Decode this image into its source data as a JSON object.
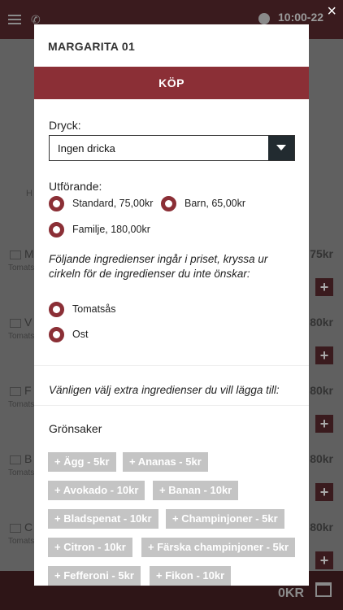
{
  "background": {
    "time": "10:00-22",
    "rows": [
      {
        "name": "M",
        "sub": "Tomats",
        "price": "75kr"
      },
      {
        "name": "V",
        "sub": "Tomats",
        "price": "80kr"
      },
      {
        "name": "F",
        "sub": "Tomats",
        "price": "80kr"
      },
      {
        "name": "B",
        "sub": "Tomats",
        "price": "80kr"
      },
      {
        "name": "C",
        "sub": "Tomats",
        "price": "80kr"
      }
    ],
    "hint": "H",
    "total": "0KR",
    "plus": "+",
    "close": "×"
  },
  "modal": {
    "title": "MARGARITA 01",
    "buy_label": "KÖP",
    "drink_label": "Dryck:",
    "drink_selected": "Ingen dricka",
    "size_label": "Utförande:",
    "sizes": [
      {
        "label": "Standard, 75,00kr",
        "selected": true
      },
      {
        "label": "Barn, 65,00kr",
        "selected": false
      },
      {
        "label": "Familje, 180,00kr",
        "selected": false
      }
    ],
    "included_note": "Följande ingredienser ingår i priset, kryssa ur cirkeln för de ingredienser du inte önskar:",
    "included": [
      "Tomatsås",
      "Ost"
    ],
    "extra_note": "Vänligen välj extra ingredienser du vill lägga till:",
    "category": "Grönsaker",
    "extras": [
      "+ Ägg - 5kr",
      "+ Ananas - 5kr",
      "+ Avokado - 10kr",
      "+ Banan - 10kr",
      "+ Bladspenat - 10kr",
      "+ Champinjoner - 5kr",
      "+ Citron - 10kr",
      "+ Färska champinjoner - 5kr",
      "+ Fefferoni - 5kr",
      "+ Fikon - 10kr"
    ]
  },
  "colors": {
    "accent": "#8b2f36",
    "tag": "#c4c4c4",
    "select_arrow_bg": "#222b30"
  },
  "icons": [
    "menu-icon",
    "phone-icon",
    "clock-icon",
    "close-icon",
    "cart-icon",
    "chevron-down-icon"
  ]
}
